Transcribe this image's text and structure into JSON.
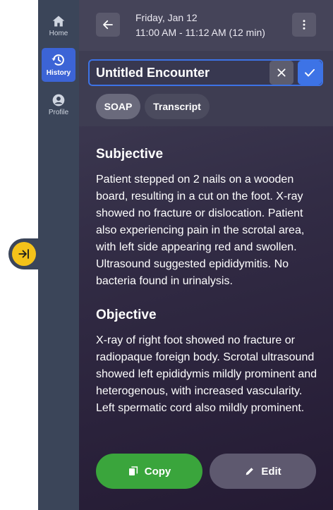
{
  "sidebar": {
    "items": [
      {
        "label": "Home",
        "icon": "home-icon",
        "active": false
      },
      {
        "label": "History",
        "icon": "history-icon",
        "active": true
      },
      {
        "label": "Profile",
        "icon": "profile-icon",
        "active": false
      }
    ]
  },
  "header": {
    "date": "Friday, Jan 12",
    "time_range": "11:00 AM - 11:12 AM (12 min)"
  },
  "title_input": {
    "value": "Untitled Encounter"
  },
  "tabs": [
    {
      "label": "SOAP",
      "selected": true
    },
    {
      "label": "Transcript",
      "selected": false
    }
  ],
  "soap": {
    "sections": [
      {
        "heading": "Subjective",
        "text": "Patient stepped on 2 nails on a wooden board, resulting in a cut on the foot. X-ray showed no fracture or dislocation. Patient also experiencing pain in the scrotal area, with left side appearing red and swollen. Ultrasound suggested epididymitis. No bacteria found in urinalysis."
      },
      {
        "heading": "Objective",
        "text": "X-ray of right foot showed no fracture or radiopaque foreign body. Scrotal ultrasound showed left epididymis mildly prominent and heterogenous, with increased vascularity. Left spermatic cord also mildly prominent."
      }
    ]
  },
  "actions": {
    "copy_label": "Copy",
    "edit_label": "Edit"
  },
  "colors": {
    "sidebar": "#3b4559",
    "accent": "#3d73e6",
    "copy_button": "#3aa53c",
    "collapse_button": "#f4c21a"
  }
}
